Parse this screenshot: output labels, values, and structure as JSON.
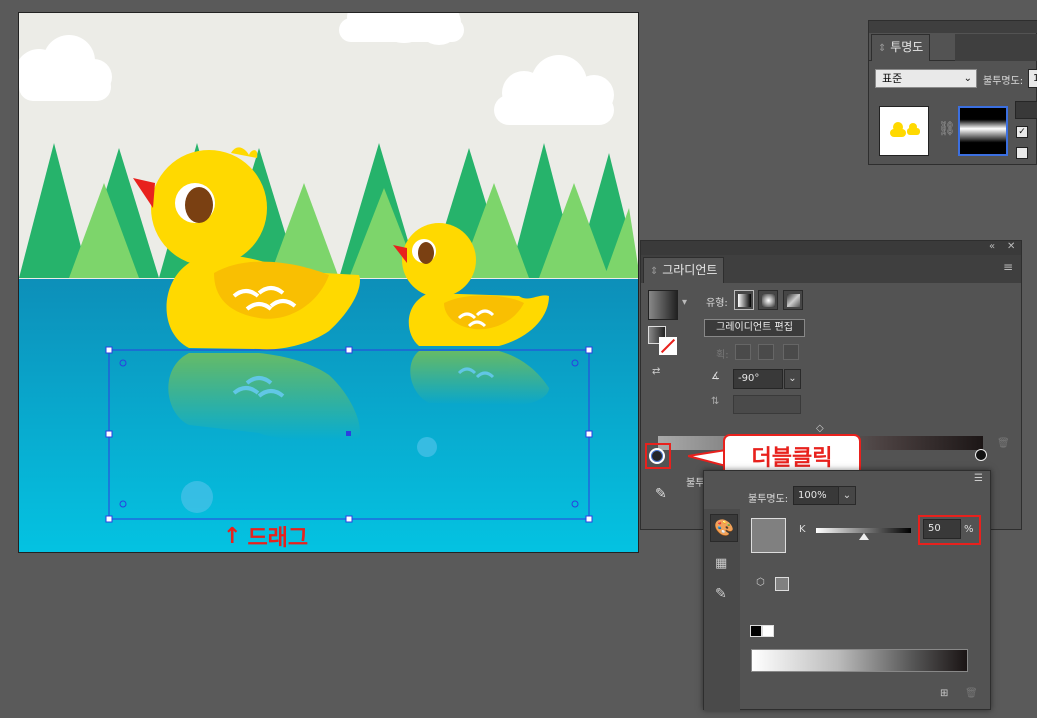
{
  "transparency_panel": {
    "tab_label": "투명도",
    "blend_mode": "표준",
    "opacity_label": "불투명도:",
    "opacity_value": "1"
  },
  "gradient_panel": {
    "tab_label": "그라디언트",
    "type_label": "유형:",
    "edit_button_label": "그레이디언트 편집",
    "angle_value": "-90°",
    "opacity_partial_label": "불투"
  },
  "color_popup": {
    "opacity_label": "불투명도:",
    "opacity_value": "100%",
    "channel_label": "K",
    "channel_value": "50",
    "percent_sign": "%"
  },
  "annotations": {
    "double_click_label": "더블클릭",
    "drag_label": "드래그",
    "drag_arrow": "↑"
  },
  "colors": {
    "highlight_red": "#e8211d",
    "selection_blue": "#2b3fe0",
    "duck_yellow": "#ffd900",
    "water_blue": "#0aa0c8"
  },
  "gradient_slider_value": 0.5
}
